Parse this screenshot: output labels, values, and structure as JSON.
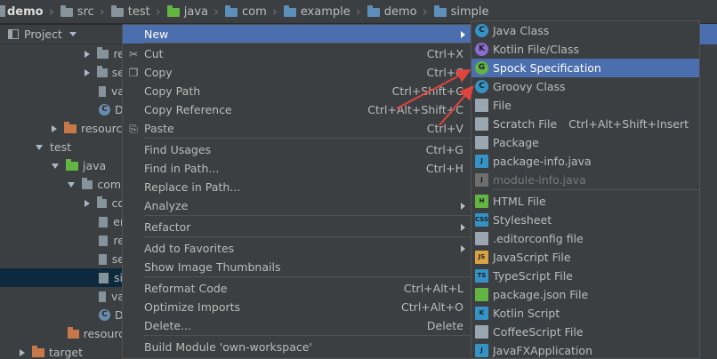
{
  "breadcrumb": [
    {
      "label": "demo",
      "icon": "module-folder-icon"
    },
    {
      "label": "src",
      "icon": "folder-icon"
    },
    {
      "label": "test",
      "icon": "folder-icon"
    },
    {
      "label": "java",
      "icon": "test-source-folder-icon"
    },
    {
      "label": "com",
      "icon": "package-folder-icon"
    },
    {
      "label": "example",
      "icon": "package-folder-icon"
    },
    {
      "label": "demo",
      "icon": "package-folder-icon"
    },
    {
      "label": "simple",
      "icon": "package-folder-icon"
    }
  ],
  "project_panel": {
    "title": "Project",
    "tree": [
      {
        "label": "re",
        "icon": "folder-icon"
      },
      {
        "label": "se",
        "icon": "folder-icon"
      },
      {
        "label": "va",
        "icon": "file-icon"
      },
      {
        "label": "D",
        "icon": "class-icon"
      },
      {
        "label": "resourc",
        "icon": "resources-folder-icon"
      },
      {
        "label": "test",
        "icon": "arrow-down"
      },
      {
        "label": "java",
        "icon": "test-source-folder-icon"
      },
      {
        "label": "com.",
        "icon": "package-folder-icon"
      },
      {
        "label": "co",
        "icon": "folder-icon"
      },
      {
        "label": "er",
        "icon": "file-icon"
      },
      {
        "label": "re",
        "icon": "file-icon"
      },
      {
        "label": "se",
        "icon": "file-icon"
      },
      {
        "label": "si",
        "icon": "file-icon"
      },
      {
        "label": "va",
        "icon": "file-icon"
      },
      {
        "label": "D",
        "icon": "class-icon"
      },
      {
        "label": "resourc",
        "icon": "resources-folder-icon"
      },
      {
        "label": "target",
        "icon": "excluded-folder-icon"
      }
    ]
  },
  "context_menu": {
    "items": [
      {
        "label": "New",
        "shortcut": "",
        "submenu": true,
        "highlighted": true
      },
      {
        "label": "Cut",
        "shortcut": "Ctrl+X",
        "icon": "scissors-icon"
      },
      {
        "label": "Copy",
        "shortcut": "Ctrl+C",
        "icon": "copy-icon"
      },
      {
        "label": "Copy Path",
        "shortcut": "Ctrl+Shift+C"
      },
      {
        "label": "Copy Reference",
        "shortcut": "Ctrl+Alt+Shift+C"
      },
      {
        "label": "Paste",
        "shortcut": "Ctrl+V",
        "icon": "paste-icon"
      },
      {
        "label": "Find Usages",
        "shortcut": "Ctrl+G"
      },
      {
        "label": "Find in Path...",
        "shortcut": "Ctrl+H"
      },
      {
        "label": "Replace in Path...",
        "shortcut": ""
      },
      {
        "label": "Analyze",
        "shortcut": "",
        "submenu": true
      },
      {
        "label": "Refactor",
        "shortcut": "",
        "submenu": true
      },
      {
        "label": "Add to Favorites",
        "shortcut": "",
        "submenu": true
      },
      {
        "label": "Show Image Thumbnails",
        "shortcut": ""
      },
      {
        "label": "Reformat Code",
        "shortcut": "Ctrl+Alt+L"
      },
      {
        "label": "Optimize Imports",
        "shortcut": "Ctrl+Alt+O"
      },
      {
        "label": "Delete...",
        "shortcut": "Delete"
      },
      {
        "label": "Build Module 'own-workspace'",
        "shortcut": ""
      }
    ]
  },
  "new_submenu": {
    "items": [
      {
        "label": "Java Class",
        "shortcut": "",
        "icon": "java-class-icon",
        "icon_color": "#3592c4",
        "glyph": "C"
      },
      {
        "label": "Kotlin File/Class",
        "shortcut": "",
        "icon": "kotlin-file-icon",
        "icon_color": "#8a6cd1",
        "glyph": "K"
      },
      {
        "label": "Spock Specification",
        "shortcut": "",
        "icon": "spock-icon",
        "icon_color": "#62b543",
        "glyph": "G",
        "highlighted": true
      },
      {
        "label": "Groovy Class",
        "shortcut": "",
        "icon": "groovy-class-icon",
        "icon_color": "#3592c4",
        "glyph": "C"
      },
      {
        "label": "File",
        "shortcut": "",
        "icon": "file-icon",
        "icon_color": "#9aa7b0",
        "glyph": ""
      },
      {
        "label": "Scratch File",
        "shortcut": "Ctrl+Alt+Shift+Insert",
        "icon": "scratch-file-icon",
        "icon_color": "#9aa7b0",
        "glyph": ""
      },
      {
        "label": "Package",
        "shortcut": "",
        "icon": "package-icon",
        "icon_color": "#9aa7b0",
        "glyph": ""
      },
      {
        "label": "package-info.java",
        "shortcut": "",
        "icon": "package-info-icon",
        "icon_color": "#3592c4",
        "glyph": "J"
      },
      {
        "label": "module-info.java",
        "shortcut": "",
        "icon": "module-info-icon",
        "icon_color": "#6e6e6e",
        "glyph": "J",
        "disabled": true
      },
      {
        "label": "HTML File",
        "shortcut": "",
        "icon": "html-file-icon",
        "icon_color": "#62b543",
        "glyph": "H"
      },
      {
        "label": "Stylesheet",
        "shortcut": "",
        "icon": "css-file-icon",
        "icon_color": "#3592c4",
        "glyph": "CSS"
      },
      {
        "label": ".editorconfig file",
        "shortcut": "",
        "icon": "editorconfig-icon",
        "icon_color": "#9aa7b0",
        "glyph": ""
      },
      {
        "label": "JavaScript File",
        "shortcut": "",
        "icon": "javascript-file-icon",
        "icon_color": "#d9a343",
        "glyph": "JS"
      },
      {
        "label": "TypeScript File",
        "shortcut": "",
        "icon": "typescript-file-icon",
        "icon_color": "#3592c4",
        "glyph": "TS"
      },
      {
        "label": "package.json File",
        "shortcut": "",
        "icon": "npm-icon",
        "icon_color": "#62b543",
        "glyph": ""
      },
      {
        "label": "Kotlin Script",
        "shortcut": "",
        "icon": "kotlin-script-icon",
        "icon_color": "#3592c4",
        "glyph": "K"
      },
      {
        "label": "CoffeeScript File",
        "shortcut": "",
        "icon": "coffeescript-icon",
        "icon_color": "#9aa7b0",
        "glyph": ""
      },
      {
        "label": "JavaFXApplication",
        "shortcut": "",
        "icon": "javafx-icon",
        "icon_color": "#3592c4",
        "glyph": "J"
      }
    ]
  },
  "colors": {
    "highlight": "#4b6eaf",
    "annotation_arrow": "#e0443e"
  }
}
